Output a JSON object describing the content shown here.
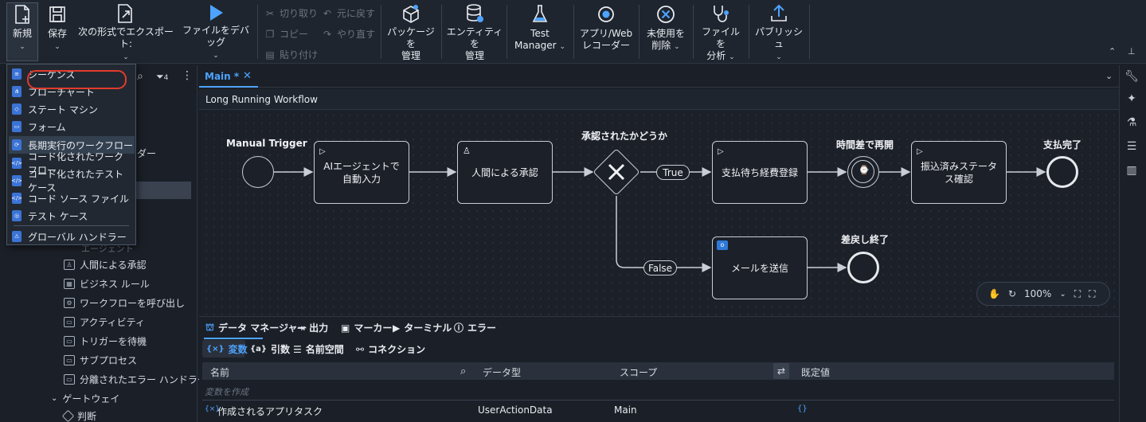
{
  "ribbon": {
    "new": "新規",
    "save": "保存",
    "export": "次の形式でエクスポート:",
    "debug": "ファイルをデバッグ",
    "cut": "切り取り",
    "undo": "元に戻す",
    "copy": "コピー",
    "redo": "やり直す",
    "paste": "貼り付け",
    "packages_1": "パッケージを",
    "packages_2": "管理",
    "entities_1": "エンティティを",
    "entities_2": "管理",
    "test_1": "Test",
    "test_2": "Manager",
    "recorder_1": "アプリ/Web",
    "recorder_2": "レコーダー",
    "unused_1": "未使用を",
    "unused_2": "削除",
    "analyze_1": "ファイルを",
    "analyze_2": "分析",
    "publish": "パブリッシュ"
  },
  "new_menu": {
    "items": [
      "シーケンス",
      "フローチャート",
      "ステート マシン",
      "フォーム",
      "長期実行のワークフロー",
      "コード化されたワークフロー",
      "コード化されたテスト ケース",
      "コード ソース ファイル",
      "テスト ケース",
      "グローバル ハンドラー"
    ],
    "highlighted": "長期実行のワークフロー"
  },
  "left_panel": {
    "partial_1": "ダー",
    "partial_2": "エージェント",
    "items": [
      "人間による承認",
      "ビジネス ルール",
      "ワークフローを呼び出し",
      "アクティビティ",
      "トリガーを待機",
      "サブプロセス",
      "分離されたエラー ハンドラー"
    ],
    "group": "ゲートウェイ",
    "group_item": "判断",
    "filter_count": "4"
  },
  "editor": {
    "tab": "Main *",
    "breadcrumb": "Long Running Workflow"
  },
  "diagram": {
    "start_label": "Manual Trigger",
    "ai_task": "AIエージェントで自動入力",
    "human_task": "人間による承認",
    "gateway_label": "承認されたかどうか",
    "true_label": "True",
    "false_label": "False",
    "register_task": "支払待ち経費登録",
    "timer_label": "時間差で再開",
    "confirm_task": "振込済みステータス確認",
    "end_label": "支払完了",
    "mail_task": "メールを送信",
    "return_label": "差戻し終了"
  },
  "zoom": "100%",
  "bottom": {
    "tabs": [
      "データ マネージャー",
      "出力",
      "マーカー",
      "ターミナル",
      "エラー"
    ],
    "subtabs": [
      "変数",
      "引数",
      "名前空間",
      "コネクション"
    ],
    "columns": [
      "名前",
      "データ型",
      "スコープ",
      "既定値"
    ],
    "placeholder": "変数を作成",
    "row": {
      "name": "作成されるアプリタスク",
      "type": "UserActionData",
      "scope": "Main",
      "default": "{}"
    }
  }
}
